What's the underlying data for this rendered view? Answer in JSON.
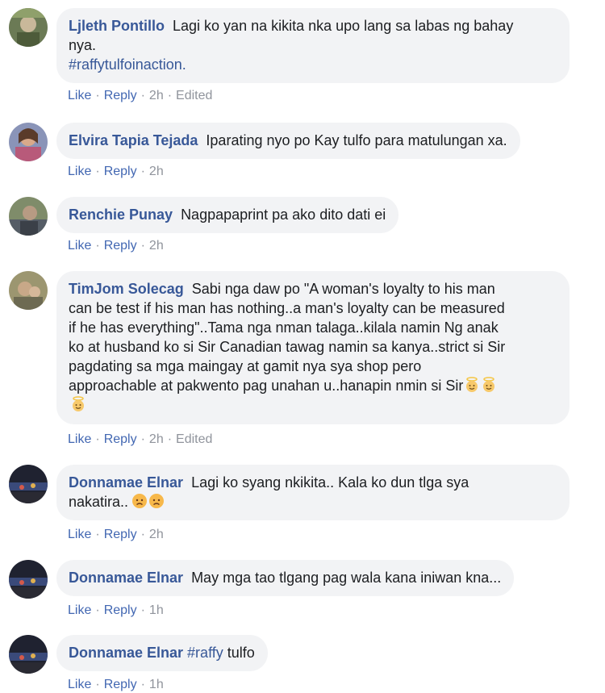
{
  "actions": {
    "like": "Like",
    "reply": "Reply",
    "edited": "Edited",
    "separator": "·"
  },
  "comments": [
    {
      "author": "Ljleth Pontillo",
      "line1": "Lagi ko yan na kikita nka upo lang sa labas ng bahay",
      "line2": "nya.",
      "hashtag": "#raffytulfoinaction.",
      "time": "2h"
    },
    {
      "author": "Elvira Tapia Tejada",
      "text": "Iparating nyo po Kay tulfo para matulungan xa.",
      "time": "2h"
    },
    {
      "author": "Renchie Punay",
      "text": "Nagpapaprint pa ako dito dati ei",
      "time": "2h"
    },
    {
      "author": "TimJom Solecag",
      "line1": "Sabi nga daw po \"A woman's loyalty to his man",
      "line2": "can be test if his man has nothing..a man's loyalty can be measured",
      "line3": "if he has everything\"..Tama nga nman talaga..kilala namin Ng anak",
      "line4": "ko at husband ko si Sir Canadian tawag namin sa kanya..strict si Sir",
      "line5": "pagdating sa mga maingay at gamit nya sya shop pero",
      "line6": "approachable at pakwento pag unahan u..hanapin nmin si Sir",
      "time": "2h"
    },
    {
      "author": "Donnamae Elnar",
      "line1": "Lagi ko syang nkikita.. Kala ko dun tlga sya",
      "line2": "nakatira..",
      "time": "2h"
    },
    {
      "author": "Donnamae Elnar",
      "text": "May mga tao tlgang pag wala kana iniwan kna...",
      "time": "1h"
    },
    {
      "author": "Donnamae Elnar",
      "hashtag": "#raffy",
      "text": " tulfo",
      "time": "1h"
    }
  ]
}
